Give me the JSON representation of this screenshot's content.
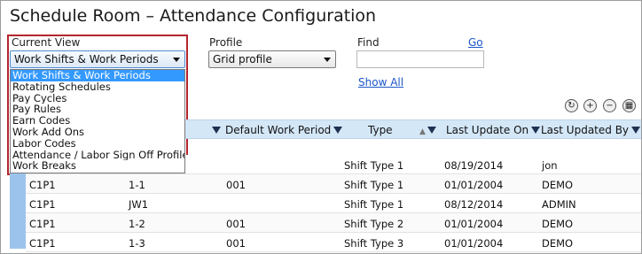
{
  "title": "Schedule Room – Attendance Configuration",
  "current_view": {
    "label": "Current View",
    "selected": "Work Shifts & Work Periods",
    "options": [
      "Work Shifts & Work Periods",
      "Rotating Schedules",
      "Pay Cycles",
      "Pay Rules",
      "Earn Codes",
      "Work Add Ons",
      "Labor Codes",
      "Attendance / Labor Sign Off Profile",
      "Work Breaks"
    ]
  },
  "profile": {
    "label": "Profile",
    "selected": "Grid profile"
  },
  "find": {
    "label": "Find",
    "go": "Go",
    "value": "",
    "show_all": "Show All"
  },
  "toolbar_icons": [
    "refresh-icon",
    "add-icon",
    "remove-icon",
    "settings-icon"
  ],
  "grid": {
    "headers": [
      "Default Work Period",
      "Type",
      "Last Update On",
      "Last Updated By"
    ],
    "rows": [
      {
        "c1": "",
        "c2": "",
        "c3": "",
        "type": "Shift Type 1",
        "updated_on": "08/19/2014",
        "updated_by": "jon"
      },
      {
        "c1": "C1P1",
        "c2": "1-1",
        "c3": "001",
        "type": "Shift Type 1",
        "updated_on": "01/01/2004",
        "updated_by": "DEMO"
      },
      {
        "c1": "C1P1",
        "c2": "JW1",
        "c3": "",
        "type": "Shift Type 1",
        "updated_on": "08/12/2014",
        "updated_by": "ADMIN"
      },
      {
        "c1": "C1P1",
        "c2": "1-2",
        "c3": "001",
        "type": "Shift Type 2",
        "updated_on": "01/01/2004",
        "updated_by": "DEMO"
      },
      {
        "c1": "C1P1",
        "c2": "1-3",
        "c3": "001",
        "type": "Shift Type 3",
        "updated_on": "01/01/2004",
        "updated_by": "DEMO"
      }
    ]
  },
  "colors": {
    "header_bg": "#d4e7f7",
    "selection": "#3399ff",
    "highlight_border": "#b5252e",
    "link": "#1b56c8"
  }
}
